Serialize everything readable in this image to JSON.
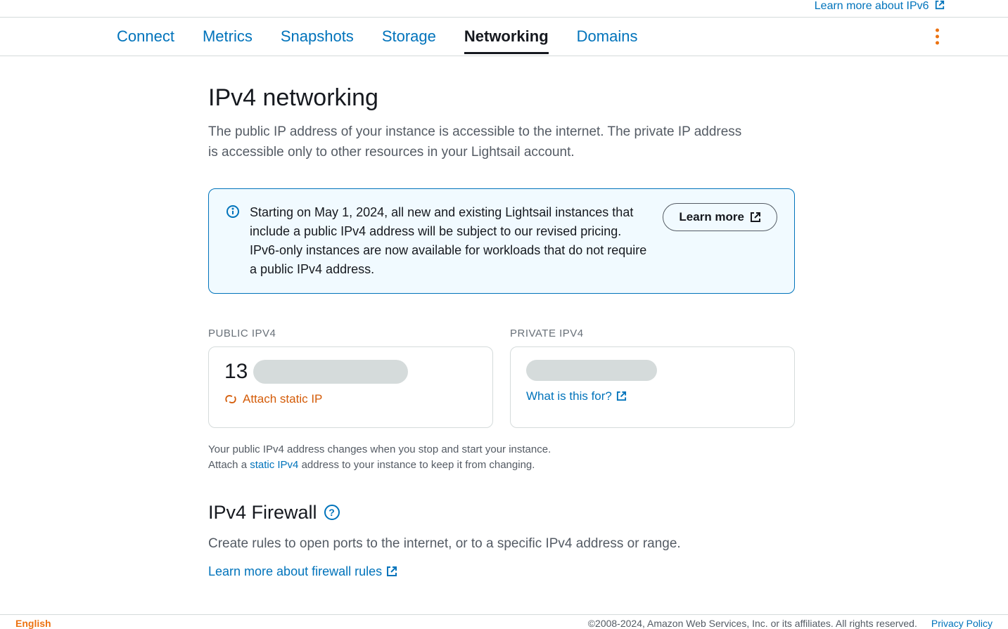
{
  "top_link": "Learn more about IPv6",
  "tabs": {
    "connect": "Connect",
    "metrics": "Metrics",
    "snapshots": "Snapshots",
    "storage": "Storage",
    "networking": "Networking",
    "domains": "Domains"
  },
  "section": {
    "title": "IPv4 networking",
    "desc": "The public IP address of your instance is accessible to the internet. The private IP address is accessible only to other resources in your Lightsail account."
  },
  "info": {
    "text": "Starting on May 1, 2024, all new and existing Lightsail instances that include a public IPv4 address will be subject to our revised pricing. IPv6-only instances are now available for workloads that do not require a public IPv4 address.",
    "button": "Learn more"
  },
  "ip": {
    "public_label": "PUBLIC IPV4",
    "public_prefix": "13",
    "attach_label": "Attach static IP",
    "private_label": "PRIVATE IPV4",
    "what_label": "What is this for?",
    "hint_line1": "Your public IPv4 address changes when you stop and start your instance.",
    "hint_prefix": "Attach a ",
    "hint_link": "static IPv4",
    "hint_suffix": " address to your instance to keep it from changing."
  },
  "firewall": {
    "title": "IPv4 Firewall",
    "desc": "Create rules to open ports to the internet, or to a specific IPv4 address or range.",
    "link": "Learn more about firewall rules"
  },
  "footer": {
    "lang": "English",
    "copyright": "©2008-2024, Amazon Web Services, Inc. or its affiliates. All rights reserved.",
    "privacy": "Privacy Policy"
  }
}
